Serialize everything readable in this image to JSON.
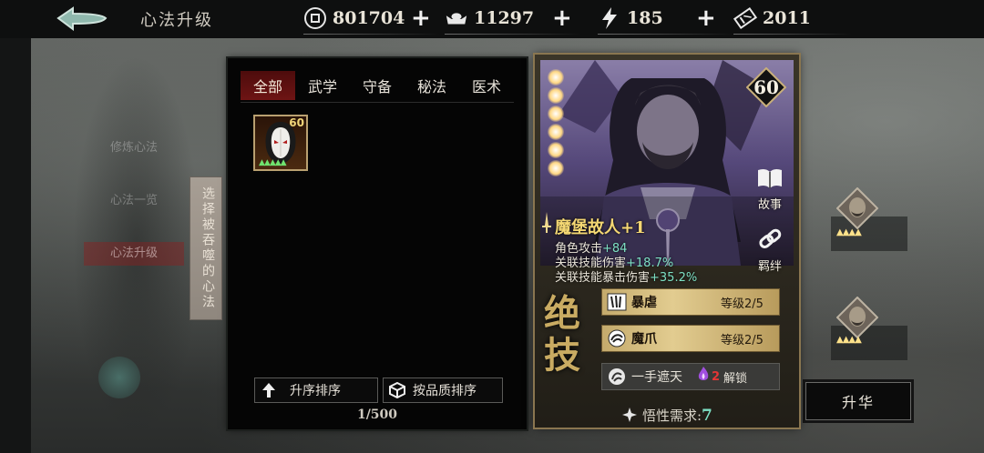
{
  "header": {
    "title": "心法升级",
    "resources": [
      {
        "icon": "coin-icon",
        "value": "801704"
      },
      {
        "icon": "silver-ingot-icon",
        "value": "11297"
      },
      {
        "icon": "lightning-icon",
        "value": "185"
      },
      {
        "icon": "ticket-icon",
        "value": "2011"
      }
    ],
    "plus": "+"
  },
  "side_label": "选择被吞噬的心法",
  "tabs": [
    {
      "label": "全部",
      "active": true
    },
    {
      "label": "武学",
      "active": false
    },
    {
      "label": "守备",
      "active": false
    },
    {
      "label": "秘法",
      "active": false
    },
    {
      "label": "医术",
      "active": false
    }
  ],
  "inventory": {
    "items": [
      {
        "level": "60",
        "pips": "▲▲▲▲▲"
      }
    ],
    "count": "1/500"
  },
  "sort": {
    "ascending": "升序排序",
    "quality": "按品质排序"
  },
  "card": {
    "level": "60",
    "story_label": "故事",
    "bond_label": "羁绊",
    "name": "魔堡故人+1",
    "stats": [
      {
        "label": "角色攻击",
        "value": "+84"
      },
      {
        "label": "关联技能伤害",
        "value": "+18.7%"
      },
      {
        "label": "关联技能暴击伤害",
        "value": "+35.2%"
      }
    ],
    "category": "绝技",
    "skills": [
      {
        "name": "暴虐",
        "level_text": "等级2/5",
        "locked": false
      },
      {
        "name": "魔爪",
        "level_text": "等级2/5",
        "locked": false
      },
      {
        "name": "一手遮天",
        "unlock_num": "2",
        "unlock_text": "解锁",
        "locked": true
      }
    ],
    "requirement_label": "悟性需求:",
    "requirement_value": "7"
  },
  "right_slots": [
    {
      "pips": "▲▲▲▲"
    },
    {
      "pips": "▲▲▲▲"
    }
  ],
  "upgrade_button": "升华",
  "ghost_menu": [
    "修炼心法",
    "心法一览",
    "心法升级"
  ]
}
